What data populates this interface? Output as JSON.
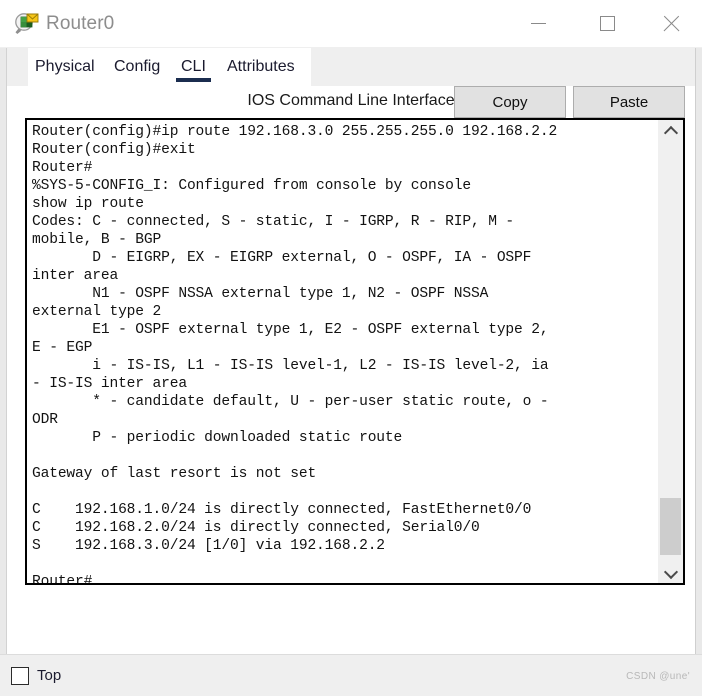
{
  "window": {
    "title": "Router0",
    "icon": "router-magnifier-icon",
    "controls": {
      "minimize": "minimize-icon",
      "maximize": "maximize-icon",
      "close": "close-icon"
    }
  },
  "tabs": [
    {
      "label": "Physical",
      "active": false
    },
    {
      "label": "Config",
      "active": false
    },
    {
      "label": "CLI",
      "active": true
    },
    {
      "label": "Attributes",
      "active": false
    }
  ],
  "panel": {
    "title": "IOS Command Line Interface"
  },
  "terminal": {
    "text": "Router(config)#ip route 192.168.3.0 255.255.255.0 192.168.2.2\nRouter(config)#exit\nRouter#\n%SYS-5-CONFIG_I: Configured from console by console\nshow ip route\nCodes: C - connected, S - static, I - IGRP, R - RIP, M -\nmobile, B - BGP\n       D - EIGRP, EX - EIGRP external, O - OSPF, IA - OSPF\ninter area\n       N1 - OSPF NSSA external type 1, N2 - OSPF NSSA\nexternal type 2\n       E1 - OSPF external type 1, E2 - OSPF external type 2,\nE - EGP\n       i - IS-IS, L1 - IS-IS level-1, L2 - IS-IS level-2, ia\n- IS-IS inter area\n       * - candidate default, U - per-user static route, o -\nODR\n       P - periodic downloaded static route\n\nGateway of last resort is not set\n\nC    192.168.1.0/24 is directly connected, FastEthernet0/0\nC    192.168.2.0/24 is directly connected, Serial0/0\nS    192.168.3.0/24 [1/0] via 192.168.2.2\n\nRouter#",
    "scrollbar": {
      "up_arrow": "chevron-up-icon",
      "down_arrow": "chevron-down-icon"
    }
  },
  "actions": {
    "copy_label": "Copy",
    "paste_label": "Paste"
  },
  "statusbar": {
    "top_checkbox_label": "Top",
    "top_checked": false,
    "watermark": "CSDN @une'"
  },
  "colors": {
    "tab_active_underline": "#1b2d4f",
    "window_bg": "#ffffff",
    "chrome_bg": "#efefef",
    "terminal_border": "#000000",
    "button_bg": "#e1e1e1"
  }
}
